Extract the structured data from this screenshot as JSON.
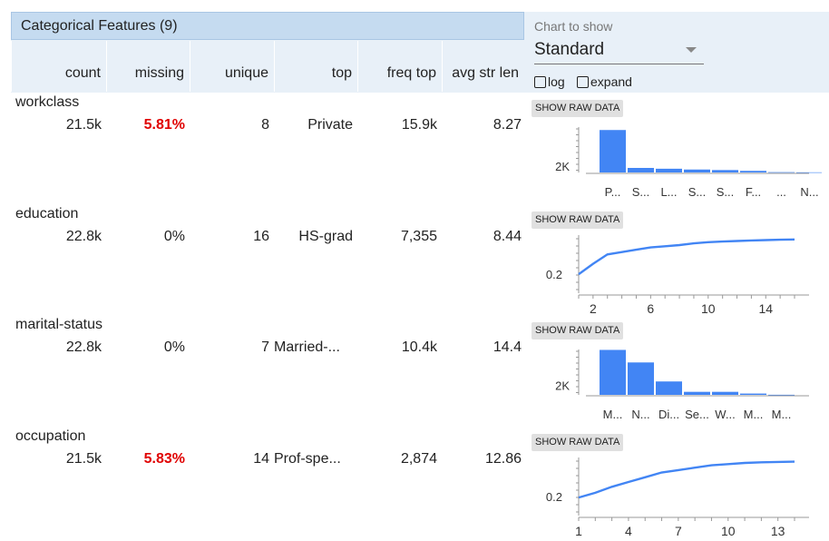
{
  "section": {
    "title": "Categorical Features (9)"
  },
  "columns": [
    "count",
    "missing",
    "unique",
    "top",
    "freq top",
    "avg str len"
  ],
  "controls": {
    "chart_label": "Chart to show",
    "chart_value": "Standard",
    "log_label": "log",
    "expand_label": "expand",
    "log_checked": false,
    "expand_checked": false
  },
  "colors": {
    "bar": "#4285f4",
    "warn": "#e00000",
    "header": "#c5dbf0",
    "header_band": "#e8f0f8"
  },
  "raw_button_label": "SHOW RAW DATA",
  "rows": [
    {
      "name": "workclass",
      "count": "21.5k",
      "missing": "5.81%",
      "missing_warn": true,
      "unique": "8",
      "top": "Private",
      "freq_top": "15.9k",
      "avg_str_len": "8.27",
      "chart_data": {
        "type": "bar",
        "categories": [
          "P...",
          "S...",
          "L...",
          "S...",
          "S...",
          "F...",
          "...",
          "N..."
        ],
        "values": [
          15900,
          1700,
          1400,
          1100,
          900,
          600,
          120,
          60
        ],
        "y_tick_label": "2K",
        "y_tick_value": 2000,
        "ylim": [
          0,
          17000
        ]
      }
    },
    {
      "name": "education",
      "count": "22.8k",
      "missing": "0%",
      "missing_warn": false,
      "unique": "16",
      "top": "HS-grad",
      "freq_top": "7,355",
      "avg_str_len": "8.44",
      "chart_data": {
        "type": "line",
        "x": [
          1,
          2,
          3,
          4,
          5,
          6,
          7,
          8,
          9,
          10,
          11,
          12,
          13,
          14,
          15,
          16
        ],
        "values": [
          0.2,
          0.29,
          0.37,
          0.39,
          0.41,
          0.43,
          0.44,
          0.45,
          0.465,
          0.475,
          0.48,
          0.485,
          0.49,
          0.493,
          0.496,
          0.498
        ],
        "x_ticks": [
          "2",
          "6",
          "10",
          "14"
        ],
        "x_tick_values": [
          2,
          6,
          10,
          14
        ],
        "y_tick_label": "0.2",
        "y_tick_value": 0.2,
        "ylim": [
          0.1,
          0.52
        ]
      }
    },
    {
      "name": "marital-status",
      "count": "22.8k",
      "missing": "0%",
      "missing_warn": false,
      "unique": "7",
      "top": "Married-...",
      "freq_top": "10.4k",
      "avg_str_len": "14.4",
      "chart_data": {
        "type": "bar",
        "categories": [
          "M...",
          "N...",
          "Di...",
          "Se...",
          "W...",
          "M...",
          "M..."
        ],
        "values": [
          10400,
          7500,
          3100,
          700,
          700,
          300,
          20
        ],
        "y_tick_label": "2K",
        "y_tick_value": 2000,
        "ylim": [
          0,
          10500
        ]
      }
    },
    {
      "name": "occupation",
      "count": "21.5k",
      "missing": "5.83%",
      "missing_warn": true,
      "unique": "14",
      "top": "Prof-spe...",
      "freq_top": "2,874",
      "avg_str_len": "12.86",
      "chart_data": {
        "type": "line",
        "x": [
          1,
          2,
          3,
          4,
          5,
          6,
          7,
          8,
          9,
          10,
          11,
          12,
          13,
          14
        ],
        "values": [
          0.19,
          0.23,
          0.28,
          0.32,
          0.36,
          0.4,
          0.42,
          0.44,
          0.46,
          0.47,
          0.48,
          0.485,
          0.488,
          0.49
        ],
        "x_ticks": [
          "1",
          "4",
          "7",
          "10",
          "13"
        ],
        "x_tick_values": [
          1,
          4,
          7,
          10,
          13
        ],
        "y_tick_label": "0.2",
        "y_tick_value": 0.2,
        "ylim": [
          0.1,
          0.51
        ]
      }
    }
  ]
}
